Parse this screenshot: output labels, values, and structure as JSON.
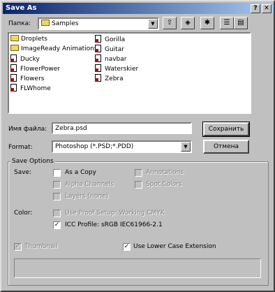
{
  "window": {
    "title": "Save As",
    "help_glyph": "?",
    "close_glyph": "✕"
  },
  "toolbar": {
    "folder_label": "Папка:",
    "folder_value": "Samples",
    "combo_arrow": "▼"
  },
  "files": [
    {
      "name": "Droplets",
      "type": "folder"
    },
    {
      "name": "ImageReady Animations",
      "type": "folder"
    },
    {
      "name": "Ducky",
      "type": "doc"
    },
    {
      "name": "FlowerPower",
      "type": "doc"
    },
    {
      "name": "Flowers",
      "type": "doc"
    },
    {
      "name": "FLWhome",
      "type": "doc"
    },
    {
      "name": "Gorilla",
      "type": "doc"
    },
    {
      "name": "Guitar",
      "type": "doc"
    },
    {
      "name": "navbar",
      "type": "doc"
    },
    {
      "name": "Waterskier",
      "type": "doc"
    },
    {
      "name": "Zebra",
      "type": "doc"
    }
  ],
  "filename": {
    "label": "Имя файла:",
    "value": "Zebra.psd"
  },
  "format": {
    "label": "Format:",
    "value": "Photoshop (*.PSD;*.PDD)"
  },
  "buttons": {
    "save": "Сохранить",
    "cancel": "Отмена"
  },
  "save_options": {
    "title": "Save Options",
    "save_label": "Save:",
    "as_copy": {
      "label": "As a Copy",
      "checked": false,
      "enabled": true
    },
    "annotations": {
      "label": "Annotations",
      "checked": false,
      "enabled": false
    },
    "alpha_channels": {
      "label": "Alpha Channels",
      "checked": false,
      "enabled": false
    },
    "spot_colors": {
      "label": "Spot Colors",
      "checked": false,
      "enabled": false
    },
    "layers": {
      "label": "Layers (none)",
      "checked": false,
      "enabled": false
    },
    "color_label": "Color:",
    "use_proof": {
      "label": "Use Proof Setup:  Working CMYK",
      "checked": false,
      "enabled": false
    },
    "icc_profile": {
      "label": "ICC Profile:  sRGB IEC61966-2.1",
      "checked": true,
      "enabled": true
    }
  },
  "thumbnail": {
    "label": "Thumbnail",
    "checked": true,
    "enabled": false
  },
  "lower_case": {
    "label": "Use Lower Case Extension",
    "checked": true,
    "enabled": true
  },
  "check_glyph": "✓"
}
